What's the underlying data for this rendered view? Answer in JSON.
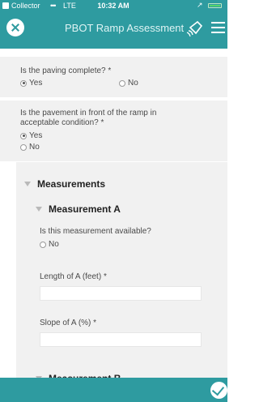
{
  "status_bar": {
    "app_name": "Collector",
    "signal": "•••",
    "network": "LTE",
    "time": "10:32 AM",
    "location_arrow": "↗"
  },
  "header": {
    "title": "PBOT Ramp Assessment"
  },
  "questions": {
    "paving": {
      "label": "Is the paving complete? *",
      "option_yes": "Yes",
      "option_no": "No"
    },
    "pavement": {
      "label_line1": "Is the pavement in front of the ramp in",
      "label_line2": "acceptable condition? *",
      "option_yes": "Yes",
      "option_no": "No"
    }
  },
  "groups": {
    "measurements": {
      "label": "Measurements"
    },
    "measurement_a": {
      "label": "Measurement A",
      "available_label": "Is this measurement available?",
      "available_option_no": "No",
      "length_label": "Length of A (feet) *",
      "length_value": "",
      "slope_label": "Slope of A (%) *",
      "slope_value": ""
    },
    "measurement_b": {
      "label": "Measurement B"
    }
  },
  "selected": {
    "paving": "Yes",
    "pavement": "Yes"
  }
}
